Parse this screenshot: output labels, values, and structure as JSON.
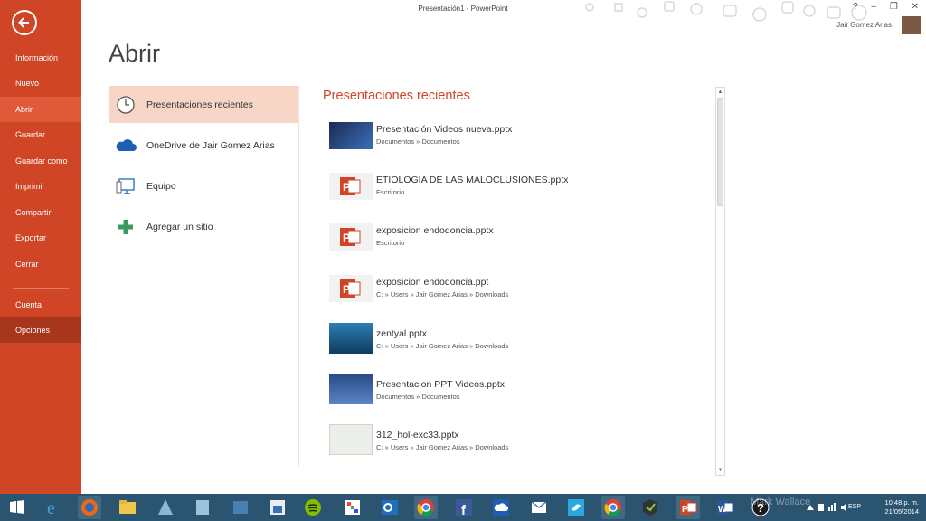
{
  "window": {
    "title": "Presentación1 - PowerPoint",
    "help": "?",
    "minimize": "–",
    "restore": "❐",
    "close": "✕",
    "user_name": "Jair Gomez Arias"
  },
  "sidebar": {
    "back_icon": "back-arrow-icon",
    "items": [
      {
        "label": "Información"
      },
      {
        "label": "Nuevo"
      },
      {
        "label": "Abrir"
      },
      {
        "label": "Guardar"
      },
      {
        "label": "Guardar como"
      },
      {
        "label": "Imprimir"
      },
      {
        "label": "Compartir"
      },
      {
        "label": "Exportar"
      },
      {
        "label": "Cerrar"
      },
      {
        "label": "Cuenta"
      },
      {
        "label": "Opciones"
      }
    ],
    "active": "Abrir",
    "colors": {
      "bg": "#d04525",
      "active": "#e05a3a",
      "hover": "#a8361c"
    }
  },
  "page": {
    "title": "Abrir"
  },
  "locations": [
    {
      "label": "Presentaciones recientes",
      "icon": "clock-icon"
    },
    {
      "label": "OneDrive de Jair Gomez Arias",
      "icon": "cloud-icon"
    },
    {
      "label": "Equipo",
      "icon": "computer-icon"
    },
    {
      "label": "Agregar un sitio",
      "icon": "plus-icon"
    }
  ],
  "recent": {
    "heading": "Presentaciones recientes",
    "files": [
      {
        "name": "Presentación Videos nueva.pptx",
        "path": "Documentos » Documentos",
        "thumb": "slide-thumbnail"
      },
      {
        "name": "ETIOLOGIA DE LAS MALOCLUSIONES.pptx",
        "path": "Escritorio",
        "thumb": "powerpoint-file-icon"
      },
      {
        "name": "exposicion endodoncia.pptx",
        "path": "Escritorio",
        "thumb": "powerpoint-file-icon"
      },
      {
        "name": "exposicion endodoncia.ppt",
        "path": "C: » Users » Jair Gomez Arias » Downloads",
        "thumb": "powerpoint-file-icon"
      },
      {
        "name": "zentyal.pptx",
        "path": "C: » Users » Jair Gomez Arias » Downloads",
        "thumb": "slide-thumbnail"
      },
      {
        "name": "Presentacion PPT Videos.pptx",
        "path": "Documentos » Documentos",
        "thumb": "slide-thumbnail"
      },
      {
        "name": "312_hol-exc33.pptx",
        "path": "C: » Users » Jair Gomez Arias » Downloads",
        "thumb": "slide-thumbnail"
      }
    ],
    "accent_color": "#d04525"
  },
  "taskbar": {
    "start_icon": "windows-start-icon",
    "apps": [
      "internet-explorer-icon",
      "firefox-icon",
      "file-explorer-icon",
      "app-icon",
      "app-icon",
      "app-icon",
      "app-icon",
      "spotify-icon",
      "app-icon",
      "outlook-icon",
      "chrome-icon",
      "facebook-icon",
      "onedrive-icon",
      "mail-icon",
      "twitter-icon",
      "chrome-icon",
      "app-icon",
      "powerpoint-icon",
      "word-icon",
      "help-icon"
    ],
    "language": "ESP",
    "time": "10:48 p. m.",
    "date": "21/05/2014",
    "watermark": "Mark Wallace",
    "bg_color": "#2b5470"
  }
}
